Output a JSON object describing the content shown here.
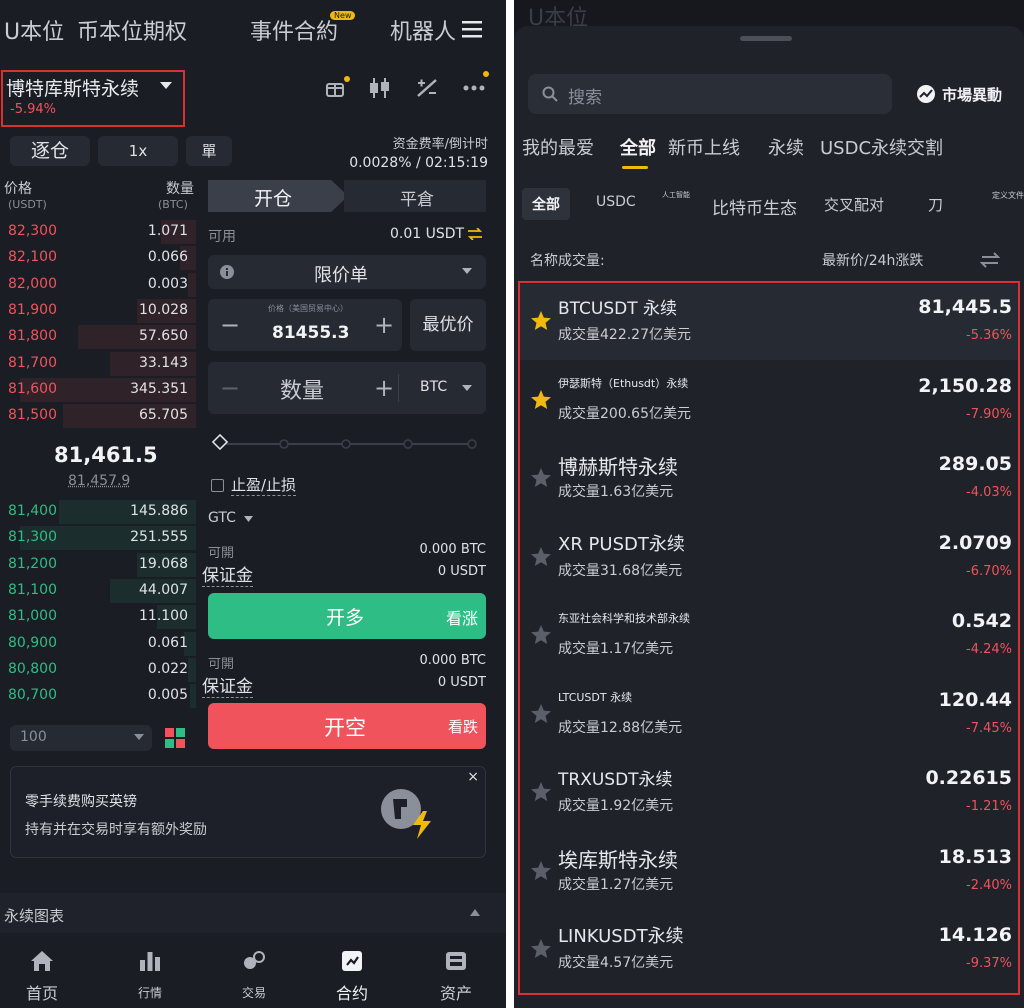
{
  "left": {
    "top_nav": {
      "tab1": "U本位",
      "tab2": "币本位期权",
      "tab3": "事件合約",
      "tab3_badge": "New",
      "tab4": "机器人"
    },
    "symbol": {
      "name": "博特库斯特永续",
      "change": "-5.94%"
    },
    "margin_mode": "逐仓",
    "leverage": "1x",
    "position_mode": "單",
    "funding": {
      "label": "资金费率/倒计时",
      "value": "0.0028% / 02:15:19"
    },
    "orderbook": {
      "price_header": "价格",
      "price_unit": "(USDT)",
      "qty_header": "数量",
      "qty_unit": "(BTC)",
      "asks": [
        {
          "price": "82,300",
          "qty": "1.071"
        },
        {
          "price": "82,100",
          "qty": "0.066"
        },
        {
          "price": "82,000",
          "qty": "0.003"
        },
        {
          "price": "81,900",
          "qty": "10.028"
        },
        {
          "price": "81,800",
          "qty": "57.650"
        },
        {
          "price": "81,700",
          "qty": "33.143"
        },
        {
          "price": "81,600",
          "qty": "345.351"
        },
        {
          "price": "81,500",
          "qty": "65.705"
        }
      ],
      "last_price": "81,461.5",
      "mark_price": "81,457.9",
      "bids": [
        {
          "price": "81,400",
          "qty": "145.886"
        },
        {
          "price": "81,300",
          "qty": "251.555"
        },
        {
          "price": "81,200",
          "qty": "19.068"
        },
        {
          "price": "81,100",
          "qty": "44.007"
        },
        {
          "price": "81,000",
          "qty": "11.100"
        },
        {
          "price": "80,900",
          "qty": "0.061"
        },
        {
          "price": "80,800",
          "qty": "0.022"
        },
        {
          "price": "80,700",
          "qty": "0.005"
        }
      ],
      "depth_value": "100"
    },
    "order_form": {
      "open_tab": "开仓",
      "close_tab": "平倉",
      "available_label": "可用",
      "available_value": "0.01 USDT",
      "order_type": "限价单",
      "price_caption": "价格（美国贸易中心）",
      "price_value": "81455.3",
      "best_price": "最优价",
      "qty_placeholder": "数量",
      "qty_unit": "BTC",
      "tpsl_label": "止盈/止损",
      "tif": "GTC",
      "long_avail_label": "可開",
      "long_avail_value": "0.000 BTC",
      "long_margin_label": "保证金",
      "long_margin_value": "0 USDT",
      "long_button": "开多",
      "long_side_label": "看涨",
      "short_avail_label": "可開",
      "short_avail_value": "0.000 BTC",
      "short_margin_label": "保证金",
      "short_margin_value": "0 USDT",
      "short_button": "开空",
      "short_side_label": "看跌"
    },
    "promo": {
      "line1": "零手续费购买英镑",
      "line2": "持有并在交易时享有额外奖励"
    },
    "chart_bar": "永续图表",
    "bottom_nav": [
      {
        "label": "首页",
        "icon": "home-icon"
      },
      {
        "label": "行情",
        "icon": "market-icon"
      },
      {
        "label": "交易",
        "icon": "trade-icon"
      },
      {
        "label": "合约",
        "icon": "futures-icon"
      },
      {
        "label": "资产",
        "icon": "wallet-icon"
      }
    ],
    "colors": {
      "red": "#f0535c",
      "green": "#2ebd85",
      "bg": "#1a1d24"
    }
  },
  "right": {
    "search_placeholder": "搜索",
    "market_move": "市場異動",
    "tabs": [
      "我的最爱",
      "全部",
      "新币上线",
      "永续",
      "USDC永续交割"
    ],
    "active_tab": "全部",
    "subtabs": [
      "全部",
      "USDC",
      "人工智能",
      "比特币生态",
      "交叉配对",
      "刀",
      "定义文件"
    ],
    "header_left": "名称成交量:",
    "header_right": "最新价/24h涨跌",
    "rows": [
      {
        "name": "BTCUSDT 永续",
        "volume": "成交量422.27亿美元",
        "price": "81,445.5",
        "change": "-5.36%",
        "fav": true
      },
      {
        "name": "伊瑟斯特（Ethusdt）永续",
        "volume": "成交量200.65亿美元",
        "price": "2,150.28",
        "change": "-7.90%",
        "fav": true
      },
      {
        "name": "博赫斯特永续",
        "volume": "成交量1.63亿美元",
        "price": "289.05",
        "change": "-4.03%",
        "fav": false
      },
      {
        "name": "XR PUSDT永续",
        "volume": "成交量31.68亿美元",
        "price": "2.0709",
        "change": "-6.70%",
        "fav": false
      },
      {
        "name": "东亚社会科学和技术部永续",
        "volume": "成交量1.17亿美元",
        "price": "0.542",
        "change": "-4.24%",
        "fav": false
      },
      {
        "name": "LTCUSDT 永续",
        "volume": "成交量12.88亿美元",
        "price": "120.44",
        "change": "-7.45%",
        "fav": false
      },
      {
        "name": "TRXUSDT永续",
        "volume": "成交量1.92亿美元",
        "price": "0.22615",
        "change": "-1.21%",
        "fav": false
      },
      {
        "name": "埃库斯特永续",
        "volume": "成交量1.27亿美元",
        "price": "18.513",
        "change": "-2.40%",
        "fav": false
      },
      {
        "name": "LINKUSDT永续",
        "volume": "成交量4.57亿美元",
        "price": "14.126",
        "change": "-9.37%",
        "fav": false
      }
    ]
  }
}
